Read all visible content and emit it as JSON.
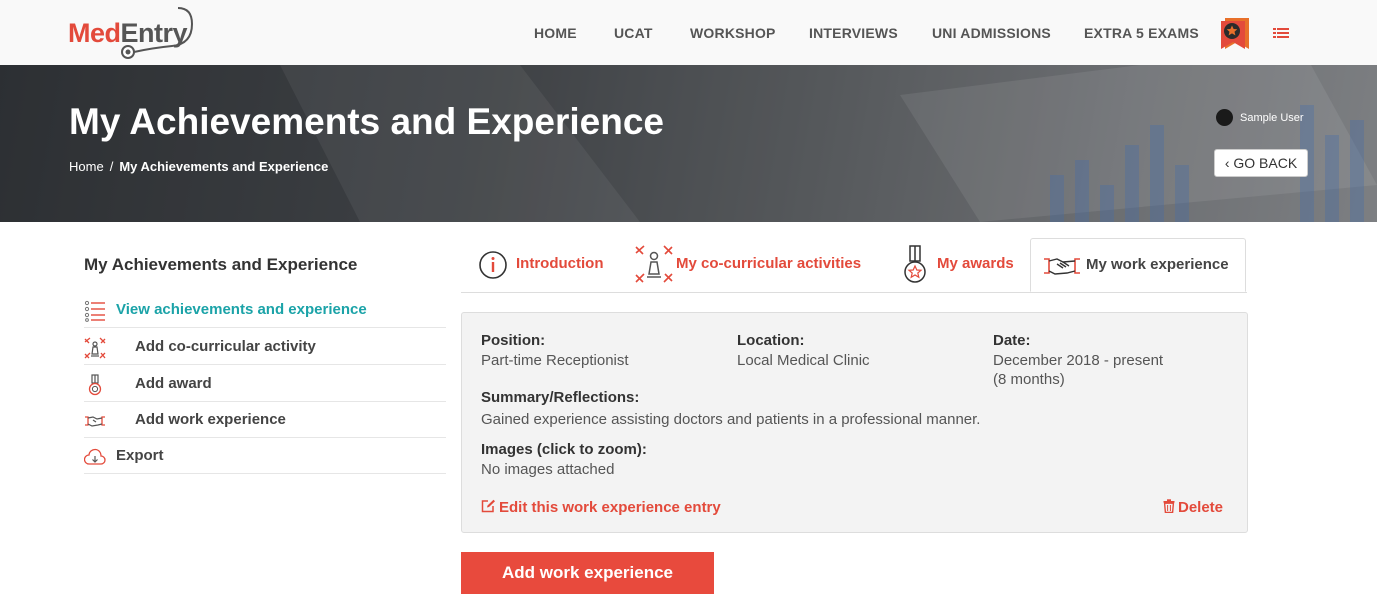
{
  "brand": {
    "logo_part1": "Med",
    "logo_part2": "Entry"
  },
  "nav": {
    "items": [
      {
        "label": "HOME"
      },
      {
        "label": "UCAT"
      },
      {
        "label": "WORKSHOP"
      },
      {
        "label": "INTERVIEWS"
      },
      {
        "label": "UNI ADMISSIONS"
      },
      {
        "label": "EXTRA 5 EXAMS"
      }
    ],
    "badge_icon": "bookmark-star-icon",
    "menu_icon": "list-menu-icon"
  },
  "hero": {
    "title": "My Achievements and Experience",
    "breadcrumb": {
      "home": "Home",
      "separator": "/",
      "current": "My Achievements and Experience"
    },
    "user_name": "Sample User",
    "go_back": "‹ GO BACK"
  },
  "sidebar": {
    "title": "My Achievements and Experience",
    "items": [
      {
        "label": "View achievements and experience",
        "icon": "checklist-icon",
        "active": true
      },
      {
        "label": "Add co-curricular activity",
        "icon": "activities-icon",
        "active": false
      },
      {
        "label": "Add award",
        "icon": "medal-icon",
        "active": false
      },
      {
        "label": "Add work experience",
        "icon": "handshake-icon",
        "active": false
      },
      {
        "label": "Export",
        "icon": "cloud-export-icon",
        "active": false
      }
    ]
  },
  "tabs": [
    {
      "label": "Introduction",
      "icon": "info-icon",
      "active": false
    },
    {
      "label": "My co-curricular activities",
      "icon": "activities-icon",
      "active": false
    },
    {
      "label": "My awards",
      "icon": "medal-icon",
      "active": false
    },
    {
      "label": "My work experience",
      "icon": "handshake-icon",
      "active": true
    }
  ],
  "entry": {
    "position_label": "Position:",
    "position_value": "Part-time Receptionist",
    "location_label": "Location:",
    "location_value": "Local Medical Clinic",
    "date_label": "Date:",
    "date_value_line1": "December 2018 - present",
    "date_value_line2": "(8 months)",
    "summary_label": "Summary/Reflections:",
    "summary_value": "Gained experience assisting doctors and patients in a professional manner.",
    "images_label": "Images (click to zoom):",
    "images_value": "No images attached",
    "edit_label": "Edit this work experience entry",
    "delete_label": "Delete"
  },
  "add_button": "Add work experience",
  "colors": {
    "accent": "#e34a3b",
    "active_link": "#1ba3a8",
    "card_bg": "#f3f3f3"
  }
}
